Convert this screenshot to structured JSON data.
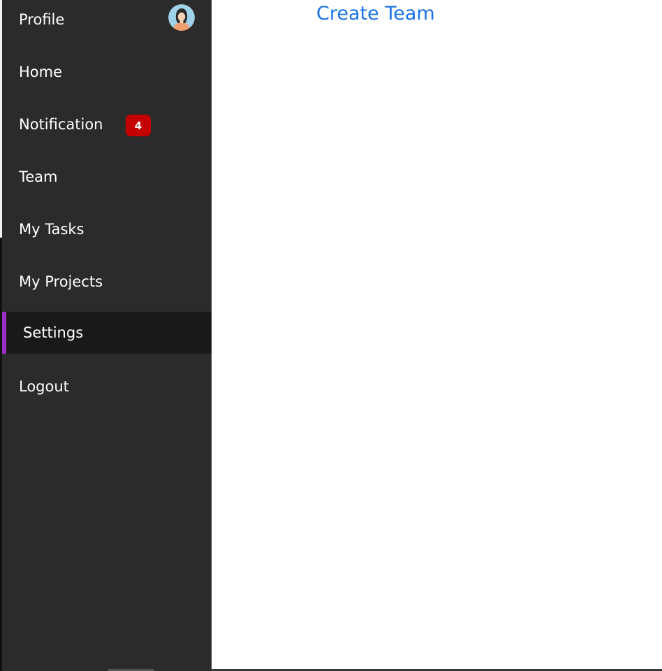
{
  "sidebar": {
    "items": [
      {
        "label": "Profile",
        "icon": "avatar"
      },
      {
        "label": "Home"
      },
      {
        "label": "Notification",
        "badge": "4"
      },
      {
        "label": "Team"
      },
      {
        "label": "My Tasks"
      },
      {
        "label": "My Projects"
      },
      {
        "label": "Settings",
        "active": true
      },
      {
        "label": "Logout"
      }
    ]
  },
  "main": {
    "create_team_label": "Create Team"
  },
  "colors": {
    "sidebar_bg": "#2b2b2b",
    "active_item_bg": "#191919",
    "active_accent": "#9b30c8",
    "badge_bg": "#c40000",
    "link": "#1a73e8",
    "avatar_bg": "#9fd3ea"
  }
}
